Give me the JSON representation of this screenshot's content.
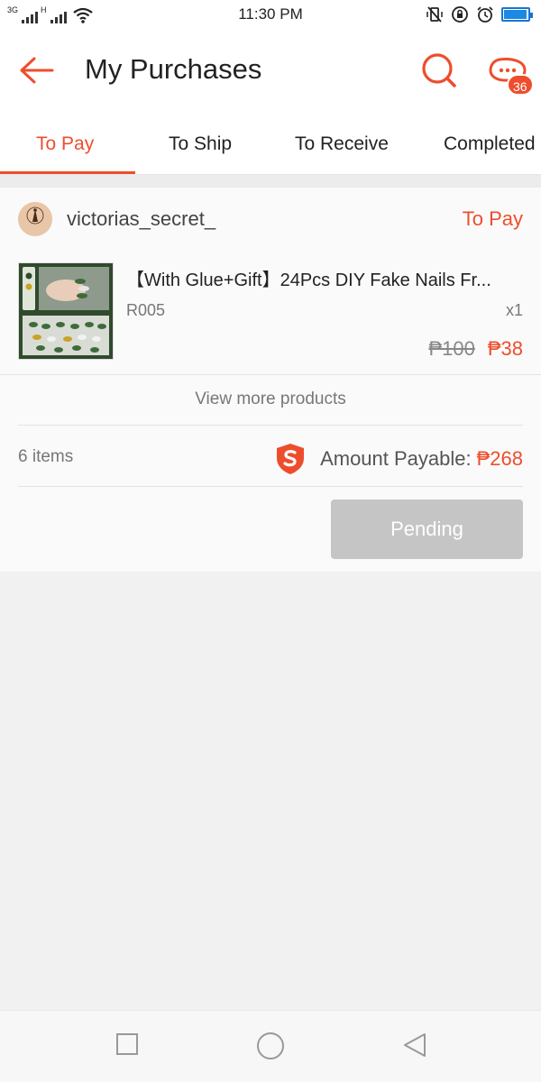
{
  "status_bar": {
    "network_label": "3G",
    "network_label_2": "H",
    "time": "11:30 PM",
    "battery_level": 0.95
  },
  "header": {
    "title": "My Purchases",
    "chat_badge": "36"
  },
  "tabs": [
    {
      "label": "To Pay",
      "active": true
    },
    {
      "label": "To Ship",
      "active": false
    },
    {
      "label": "To Receive",
      "active": false
    },
    {
      "label": "Completed",
      "active": false
    }
  ],
  "order": {
    "shop_name": "victorias_secret_",
    "status": "To Pay",
    "product": {
      "name": "【With Glue+Gift】24Pcs DIY Fake Nails Fr...",
      "variation": "R005",
      "quantity": "x1",
      "original_price": "₱100",
      "price": "₱38"
    },
    "view_more": "View more products",
    "items_count": "6 items",
    "payable_label": "Amount Payable:",
    "payable_value": "₱268",
    "action_button": "Pending"
  },
  "colors": {
    "accent": "#ee4d2d",
    "disabled_button": "#c5c5c5"
  }
}
